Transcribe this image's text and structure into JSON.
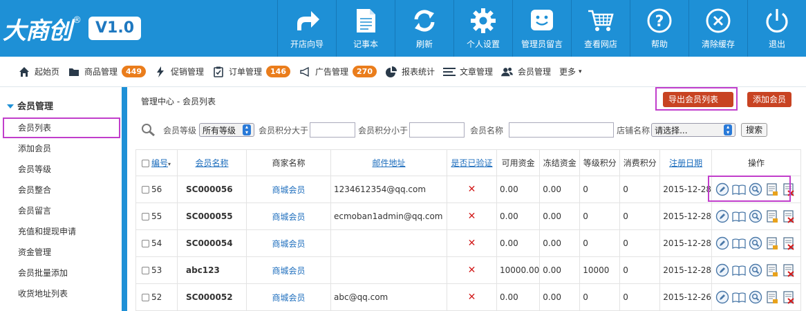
{
  "logo": {
    "text": "大商创",
    "reg": "®",
    "version": "V1.0"
  },
  "toolbar": [
    {
      "label": "开店向导",
      "icon": "share-arrow-icon"
    },
    {
      "label": "记事本",
      "icon": "notepad-icon"
    },
    {
      "label": "刷新",
      "icon": "refresh-icon"
    },
    {
      "label": "个人设置",
      "icon": "gear-icon"
    },
    {
      "label": "管理员留言",
      "icon": "message-smile-icon"
    },
    {
      "label": "查看网店",
      "icon": "cart-icon"
    },
    {
      "label": "帮助",
      "icon": "help-icon"
    },
    {
      "label": "清除缓存",
      "icon": "clear-icon"
    },
    {
      "label": "退出",
      "icon": "power-icon"
    }
  ],
  "nav": [
    {
      "label": "起始页",
      "icon": "home-icon",
      "badge": ""
    },
    {
      "label": "商品管理",
      "icon": "folder-icon",
      "badge": "449"
    },
    {
      "label": "促销管理",
      "icon": "lightning-icon",
      "badge": ""
    },
    {
      "label": "订单管理",
      "icon": "clipboard-icon",
      "badge": "146"
    },
    {
      "label": "广告管理",
      "icon": "megaphone-icon",
      "badge": "270"
    },
    {
      "label": "报表统计",
      "icon": "pie-chart-icon",
      "badge": ""
    },
    {
      "label": "文章管理",
      "icon": "list-icon",
      "badge": ""
    },
    {
      "label": "会员管理",
      "icon": "users-icon",
      "badge": ""
    },
    {
      "label": "更多",
      "icon": "",
      "badge": ""
    }
  ],
  "sidebar": {
    "title": "会员管理",
    "items": [
      "会员列表",
      "添加会员",
      "会员等级",
      "会员整合",
      "会员留言",
      "充值和提现申请",
      "资金管理",
      "会员批量添加",
      "收货地址列表"
    ]
  },
  "breadcrumb": {
    "root": "管理中心",
    "sep": " - ",
    "current": "会员列表"
  },
  "actions": {
    "export": "导出会员列表",
    "add": "添加会员"
  },
  "filter": {
    "level_label": "会员等级",
    "level_value": "所有等级",
    "points_gt_label": "会员积分大于",
    "points_lt_label": "会员积分小于",
    "name_label": "会员名称",
    "shop_label": "店铺名称",
    "shop_value": "请选择...",
    "search_btn": "搜索"
  },
  "table": {
    "headers": [
      "编号",
      "会员名称",
      "商家名称",
      "邮件地址",
      "是否已验证",
      "可用资金",
      "冻结资金",
      "等级积分",
      "消费积分",
      "注册日期",
      "操作"
    ],
    "rows": [
      {
        "id": "56",
        "name": "SC000056",
        "merchant": "商城会员",
        "email": "1234612354@qq.com",
        "verified": "✕",
        "avail": "0.00",
        "frozen": "0.00",
        "rank": "0",
        "pay": "0",
        "date": "2015-12-28"
      },
      {
        "id": "55",
        "name": "SC000055",
        "merchant": "商城会员",
        "email": "ecmoban1admin@qq.com",
        "verified": "✕",
        "avail": "0.00",
        "frozen": "0.00",
        "rank": "0",
        "pay": "0",
        "date": "2015-12-28"
      },
      {
        "id": "54",
        "name": "SC000054",
        "merchant": "商城会员",
        "email": "",
        "verified": "✕",
        "avail": "0.00",
        "frozen": "0.00",
        "rank": "0",
        "pay": "0",
        "date": "2015-12-28"
      },
      {
        "id": "53",
        "name": "abc123",
        "merchant": "商城会员",
        "email": "",
        "verified": "✕",
        "avail": "10000.00",
        "frozen": "0.00",
        "rank": "10000",
        "pay": "0",
        "date": "2015-12-28"
      },
      {
        "id": "52",
        "name": "SC000052",
        "merchant": "商城会员",
        "email": "abc@qq.com",
        "verified": "✕",
        "avail": "0.00",
        "frozen": "0.00",
        "rank": "0",
        "pay": "0",
        "date": "2015-12-26"
      }
    ]
  },
  "colors": {
    "brand_blue": "#1e90d6",
    "badge_orange": "#ea7d1c",
    "btn_red": "#c84322",
    "highlight": "#c13ecb",
    "link": "#1c6dbd"
  }
}
